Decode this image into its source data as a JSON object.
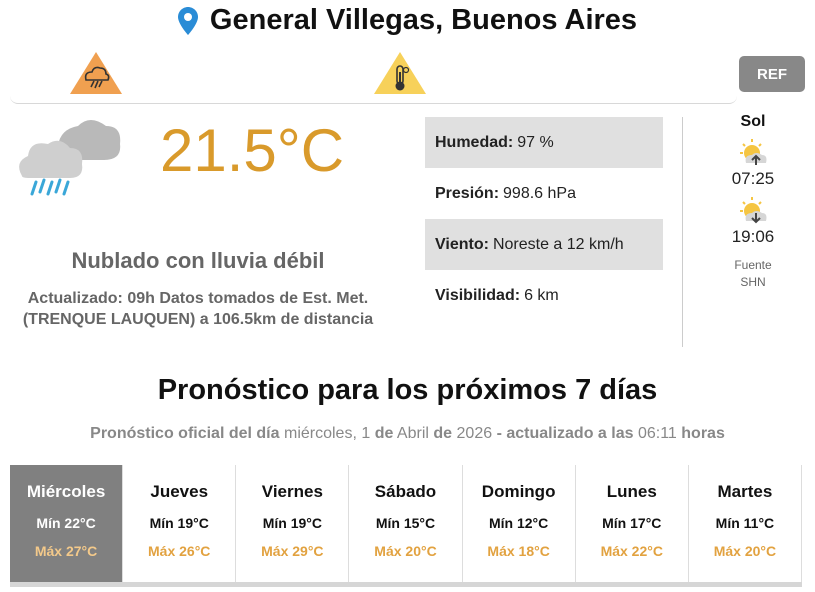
{
  "location": {
    "title": "General Villegas, Buenos Aires",
    "icon": "map-pin-icon",
    "pin_color": "#2a8cd6"
  },
  "alerts": [
    {
      "icon": "storm-alert-icon",
      "color": "#f0a050"
    },
    {
      "icon": "temperature-alert-icon",
      "color": "#f7d15a"
    }
  ],
  "ref_button": "REF",
  "current": {
    "icon": "cloud-rain-icon",
    "temperature": "21.5°C",
    "condition": "Nublado con lluvia débil",
    "updated_text": "Actualizado: 09h Datos tomados de Est. Met. (TRENQUE LAUQUEN) a 106.5km de distancia"
  },
  "details": [
    {
      "label": "Humedad:",
      "value": "97 %"
    },
    {
      "label": "Presión:",
      "value": "998.6 hPa"
    },
    {
      "label": "Viento:",
      "value": "Noreste a 12 km/h"
    },
    {
      "label": "Visibilidad:",
      "value": "6 km"
    }
  ],
  "sun": {
    "title": "Sol",
    "sunrise": "07:25",
    "sunset": "19:06",
    "source_label": "Fuente",
    "source": "SHN",
    "sunrise_icon": "sunrise-icon",
    "sunset_icon": "sunset-icon"
  },
  "forecast": {
    "title": "Pronóstico para los próximos 7 días",
    "sub_prefix": "Pronóstico oficial del día",
    "sub_day": "miércoles, 1",
    "sub_de1": "de",
    "sub_month": "Abril",
    "sub_de2": "de",
    "sub_year": "2026",
    "sub_updated": "- actualizado a las",
    "sub_time": "06:11",
    "sub_hours": "horas",
    "days": [
      {
        "name": "Miércoles",
        "min": "Mín 22°C",
        "max": "Máx 27°C"
      },
      {
        "name": "Jueves",
        "min": "Mín 19°C",
        "max": "Máx 26°C"
      },
      {
        "name": "Viernes",
        "min": "Mín 19°C",
        "max": "Máx 29°C"
      },
      {
        "name": "Sábado",
        "min": "Mín 15°C",
        "max": "Máx 20°C"
      },
      {
        "name": "Domingo",
        "min": "Mín 12°C",
        "max": "Máx 18°C"
      },
      {
        "name": "Lunes",
        "min": "Mín 17°C",
        "max": "Máx 22°C"
      },
      {
        "name": "Martes",
        "min": "Mín 11°C",
        "max": "Máx 20°C"
      }
    ]
  },
  "colors": {
    "temperature": "#d99a2b",
    "max_temp": "#e2a240",
    "active_day": "#808080"
  }
}
